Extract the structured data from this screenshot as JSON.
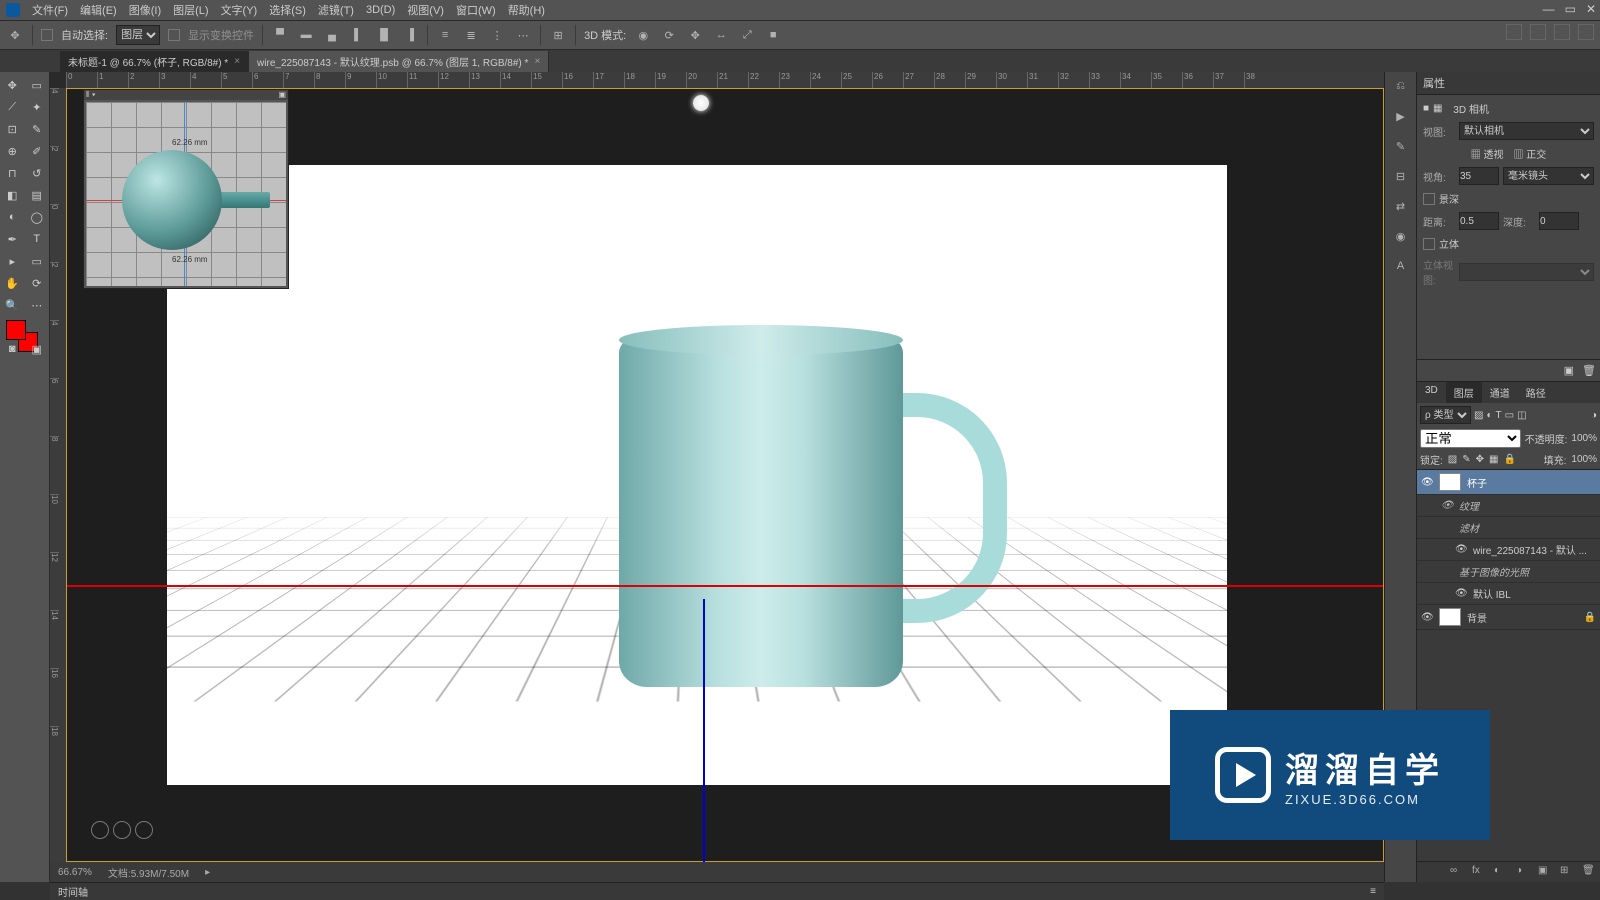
{
  "menu": {
    "items": [
      "文件(F)",
      "编辑(E)",
      "图像(I)",
      "图层(L)",
      "文字(Y)",
      "选择(S)",
      "滤镜(T)",
      "3D(D)",
      "视图(V)",
      "窗口(W)",
      "帮助(H)"
    ]
  },
  "options": {
    "auto_select": "自动选择:",
    "target": "图层",
    "show_transform": "显示变换控件",
    "mode3d": "3D 模式:"
  },
  "tabs": [
    {
      "label": "未标题-1 @ 66.7% (杯子, RGB/8#) *",
      "active": true
    },
    {
      "label": "wire_225087143 - 默认纹理.psb @ 66.7% (图层 1, RGB/8#) *",
      "active": false
    }
  ],
  "mini": {
    "dim1": "62.26 mm",
    "dim2": "62.26 mm"
  },
  "status": {
    "zoom": "66.67%",
    "doc_label": "文档:",
    "doc": "5.93M/7.50M"
  },
  "timeline": "时间轴",
  "properties": {
    "title": "属性",
    "cam_label": "3D 相机",
    "view_k": "视图:",
    "view_v": "默认相机",
    "persp": "透视",
    "ortho": "正交",
    "fov_k": "视角:",
    "fov_v": "35",
    "lens": "毫米镜头",
    "dof": "景深",
    "dist_k": "距离:",
    "dist_v": "0.5",
    "depth_k": "深度:",
    "depth_v": "0",
    "stereo": "立体",
    "stereo_view": "立体视图:"
  },
  "layer_tabs": [
    "3D",
    "图层",
    "通道",
    "路径"
  ],
  "layers": {
    "filter": "ρ 类型",
    "blend": "正常",
    "opacity_k": "不透明度:",
    "opacity_v": "100%",
    "lock_k": "锁定:",
    "fill_k": "填充:",
    "fill_v": "100%",
    "items": [
      {
        "name": "杯子",
        "eye": true,
        "sel": true,
        "thumb": true
      },
      {
        "name": "纹理",
        "sub": 1,
        "eye": true
      },
      {
        "name": "滤材",
        "sub": 1,
        "italic": true
      },
      {
        "name": "wire_225087143 - 默认 ...",
        "sub": 2,
        "eye": true
      },
      {
        "name": "基于图像的光照",
        "sub": 1,
        "italic": true
      },
      {
        "name": "默认 IBL",
        "sub": 2,
        "eye": true
      },
      {
        "name": "背景",
        "eye": true,
        "thumb": true,
        "lock": true
      }
    ]
  },
  "watermark": {
    "big": "溜溜自学",
    "small": "ZIXUE.3D66.COM"
  }
}
